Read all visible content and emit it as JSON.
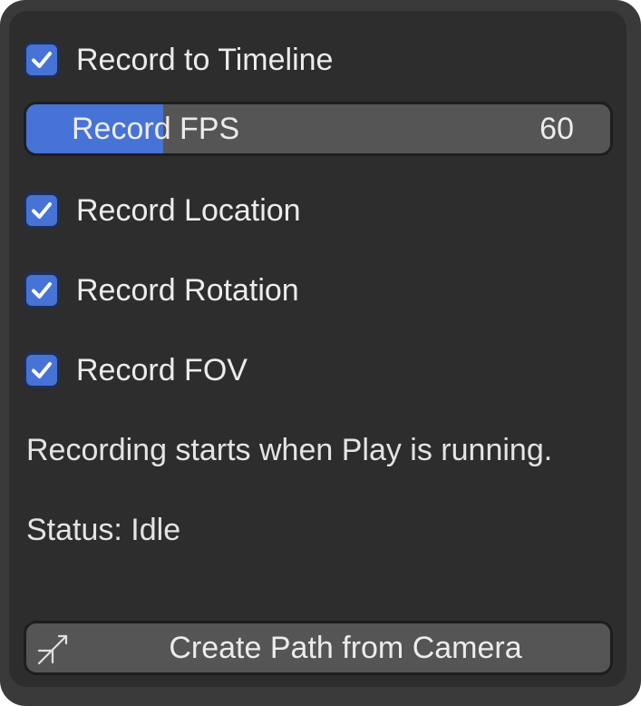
{
  "panel": {
    "record_to_timeline": {
      "label": "Record to Timeline",
      "checked": true
    },
    "fps_slider": {
      "label": "Record FPS",
      "value": "60",
      "fill_fraction": 0.235
    },
    "record_location": {
      "label": "Record Location",
      "checked": true
    },
    "record_rotation": {
      "label": "Record Rotation",
      "checked": true
    },
    "record_fov": {
      "label": "Record FOV",
      "checked": true
    },
    "hint": "Recording starts when Play is running.",
    "status": "Status: Idle",
    "create_path_button": {
      "label": "Create Path from Camera",
      "icon": "curve-path-icon"
    }
  },
  "colors": {
    "accent": "#4772d6",
    "panel_bg": "#2d2d2d",
    "control_bg": "#555555",
    "text": "#ececec"
  }
}
